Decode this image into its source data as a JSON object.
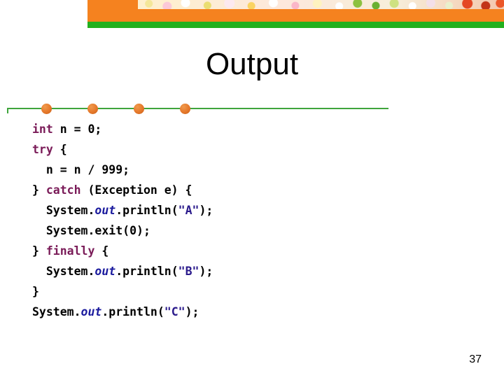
{
  "header": {
    "orange_color": "#F5821F",
    "green_color": "#22B01E",
    "photo_strip_alt": "floral-photo-strip"
  },
  "title": "Output",
  "divider": {
    "line_color": "#3FA53C",
    "dot_color": "#E5782A",
    "dot_positions": [
      49,
      115,
      181,
      247
    ]
  },
  "code": {
    "language": "java",
    "keyword_color": "#7A1B58",
    "field_color": "#1B1B9E",
    "string_color": "#2B1B8C",
    "lines": [
      {
        "indent": 0,
        "tokens": [
          {
            "t": "int",
            "c": "kw"
          },
          {
            "t": " n = 0;",
            "c": ""
          }
        ]
      },
      {
        "indent": 0,
        "tokens": [
          {
            "t": "try",
            "c": "kw"
          },
          {
            "t": " {",
            "c": ""
          }
        ]
      },
      {
        "indent": 1,
        "tokens": [
          {
            "t": "n = n / 999;",
            "c": ""
          }
        ]
      },
      {
        "indent": 0,
        "tokens": [
          {
            "t": "} ",
            "c": ""
          },
          {
            "t": "catch",
            "c": "kw"
          },
          {
            "t": " (Exception e) {",
            "c": ""
          }
        ]
      },
      {
        "indent": 1,
        "tokens": [
          {
            "t": "System.",
            "c": ""
          },
          {
            "t": "out",
            "c": "fld"
          },
          {
            "t": ".println(",
            "c": ""
          },
          {
            "t": "\"A\"",
            "c": "str"
          },
          {
            "t": ");",
            "c": ""
          }
        ]
      },
      {
        "indent": 1,
        "tokens": [
          {
            "t": "System.exit(0);",
            "c": ""
          }
        ]
      },
      {
        "indent": 0,
        "tokens": [
          {
            "t": "} ",
            "c": ""
          },
          {
            "t": "finally",
            "c": "kw"
          },
          {
            "t": " {",
            "c": ""
          }
        ]
      },
      {
        "indent": 1,
        "tokens": [
          {
            "t": "System.",
            "c": ""
          },
          {
            "t": "out",
            "c": "fld"
          },
          {
            "t": ".println(",
            "c": ""
          },
          {
            "t": "\"B\"",
            "c": "str"
          },
          {
            "t": ");",
            "c": ""
          }
        ]
      },
      {
        "indent": 0,
        "tokens": [
          {
            "t": "}",
            "c": ""
          }
        ]
      },
      {
        "indent": 0,
        "tokens": [
          {
            "t": "System.",
            "c": ""
          },
          {
            "t": "out",
            "c": "fld"
          },
          {
            "t": ".println(",
            "c": ""
          },
          {
            "t": "\"C\"",
            "c": "str"
          },
          {
            "t": ");",
            "c": ""
          }
        ]
      }
    ]
  },
  "page_number": "37"
}
